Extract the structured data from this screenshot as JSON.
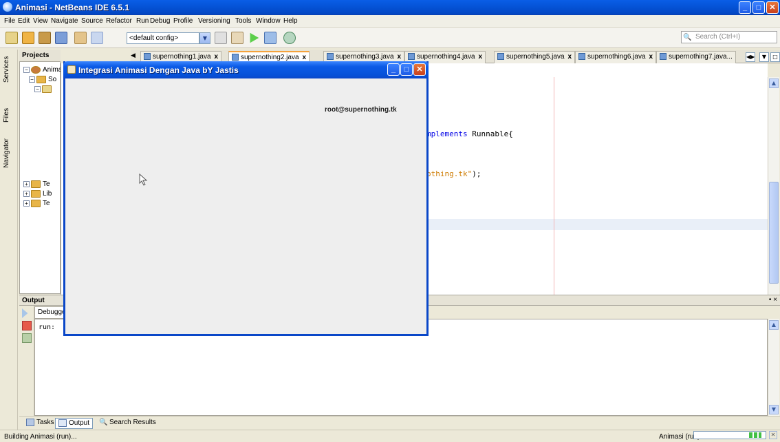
{
  "window": {
    "title": "Animasi - NetBeans IDE 6.5.1",
    "minimize": "_",
    "maximize": "□",
    "close": "✕"
  },
  "menu": [
    "File",
    "Edit",
    "View",
    "Navigate",
    "Source",
    "Refactor",
    "Run",
    "Debug",
    "Profile",
    "Versioning",
    "Tools",
    "Window",
    "Help"
  ],
  "toolbar": {
    "config_value": "<default config>",
    "search_placeholder": "Search (Ctrl+I)"
  },
  "sidetabs": [
    "Services",
    "Files",
    "Navigator"
  ],
  "projects": {
    "header": "Projects",
    "nodes": [
      "Animas",
      "So",
      "Te",
      "Lib",
      "Te"
    ]
  },
  "editor": {
    "tabs": [
      {
        "label": "supernothing1.java",
        "close": "x"
      },
      {
        "label": "supernothing2.java",
        "close": "x"
      },
      {
        "label": "supernothing3.java",
        "close": "x"
      },
      {
        "label": "supernothing4.java",
        "close": "x"
      },
      {
        "label": "supernothing5.java",
        "close": "x"
      },
      {
        "label": "supernothing6.java",
        "close": "x"
      },
      {
        "label": "supernothing7.java...",
        "close": ""
      }
    ],
    "nav_marker": "◀",
    "code_line1_kw": "mplements",
    "code_line1_rest": " Runnable{",
    "code_line2_str": "othing.tk\"",
    "code_line2_rest": ");"
  },
  "output": {
    "header": "Output",
    "tab": "Debugger",
    "run_text": "run:"
  },
  "bottom_tabs": [
    "Tasks",
    "Output",
    "Search Results"
  ],
  "status": {
    "left": "Building Animasi (run)...",
    "right": "Animasi (run)"
  },
  "java_window": {
    "title": "Integrasi Animasi Dengan Java bY Jastis",
    "label": "root@supernothing.tk"
  }
}
